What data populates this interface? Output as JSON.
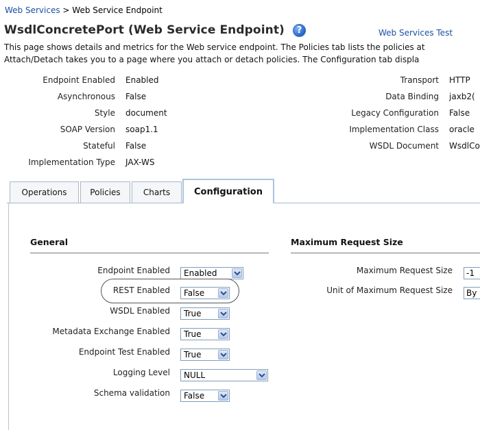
{
  "breadcrumb": {
    "link": "Web Services",
    "separator": ">",
    "current": "Web Service Endpoint"
  },
  "page": {
    "title": "WsdlConcretePort (Web Service Endpoint)",
    "help_glyph": "?",
    "web_services_test_link": "Web Services Test",
    "description_line1": "This page shows details and metrics for the Web service endpoint. The Policies tab lists the policies at",
    "description_line2": "Attach/Detach takes you to a page where you attach or detach policies. The Configuration tab displa"
  },
  "details_left": [
    {
      "label": "Endpoint Enabled",
      "value": "Enabled"
    },
    {
      "label": "Asynchronous",
      "value": "False"
    },
    {
      "label": "Style",
      "value": "document"
    },
    {
      "label": "SOAP Version",
      "value": "soap1.1"
    },
    {
      "label": "Stateful",
      "value": "False"
    },
    {
      "label": "Implementation Type",
      "value": "JAX-WS"
    }
  ],
  "details_right": [
    {
      "label": "Transport",
      "value": "HTTP"
    },
    {
      "label": "Data Binding",
      "value": "jaxb2("
    },
    {
      "label": "Legacy Configuration",
      "value": "False"
    },
    {
      "label": "Implementation Class",
      "value": "oracle"
    },
    {
      "label": "WSDL Document",
      "value": "WsdlCo"
    }
  ],
  "tabs": [
    {
      "label": "Operations",
      "active": false
    },
    {
      "label": "Policies",
      "active": false
    },
    {
      "label": "Charts",
      "active": false
    },
    {
      "label": "Configuration",
      "active": true
    }
  ],
  "general": {
    "heading": "General",
    "rows": [
      {
        "label": "Endpoint Enabled",
        "value": "Enabled"
      },
      {
        "label": "REST Enabled",
        "value": "False",
        "highlighted": true
      },
      {
        "label": "WSDL Enabled",
        "value": "True"
      },
      {
        "label": "Metadata Exchange Enabled",
        "value": "True"
      },
      {
        "label": "Endpoint Test Enabled",
        "value": "True"
      },
      {
        "label": "Logging Level",
        "value": "NULL"
      },
      {
        "label": "Schema validation",
        "value": "False"
      }
    ]
  },
  "max_request": {
    "heading": "Maximum Request Size",
    "size_label": "Maximum Request Size",
    "size_value": "-1",
    "unit_label": "Unit of Maximum Request Size",
    "unit_value": "By"
  },
  "colors": {
    "link": "#1b4fa3",
    "tab_border": "#a9b7c8",
    "select_border": "#7f9db9"
  },
  "icons": {
    "help": "help-circle-icon",
    "dropdown": "chevron-down-icon"
  }
}
